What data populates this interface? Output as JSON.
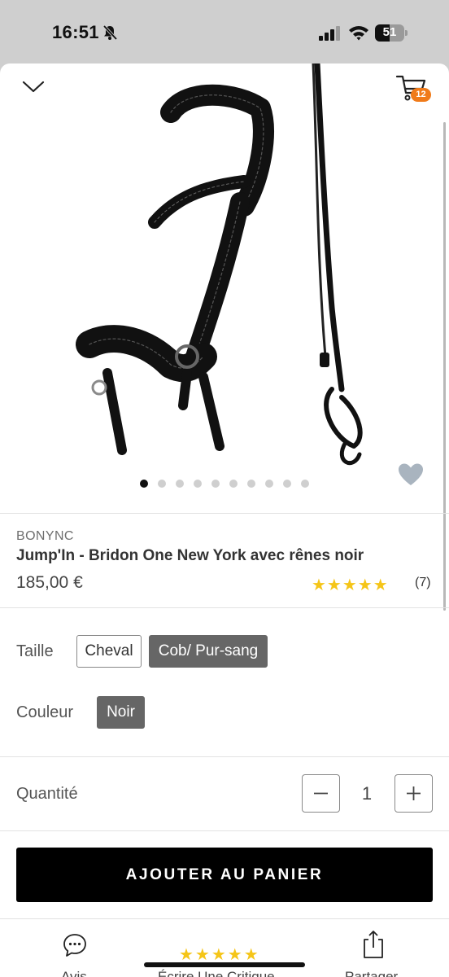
{
  "status_bar": {
    "time": "16:51",
    "battery": "51",
    "battery_level": 0.51
  },
  "header": {
    "cart_count": "12"
  },
  "gallery": {
    "image_count": 10,
    "active_index": 0
  },
  "product": {
    "brand": "BONYNC",
    "title": "Jump'In - Bridon One New York avec rênes noir",
    "price": "185,00 €",
    "rating_stars": "★★★★★",
    "rating_value": 5,
    "review_count": "(7)"
  },
  "options": {
    "size_label": "Taille",
    "sizes": [
      "Cheval",
      "Cob/ Pur-sang"
    ],
    "selected_size": "Cob/ Pur-sang",
    "color_label": "Couleur",
    "colors": [
      "Noir"
    ],
    "selected_color": "Noir"
  },
  "quantity": {
    "label": "Quantité",
    "value": "1",
    "minus": "−",
    "plus": "+"
  },
  "cta": {
    "add_to_cart": "AJOUTER AU PANIER"
  },
  "bottom_bar": {
    "reviews_label": "Avis",
    "write_review_label": "Écrire Une Critique",
    "write_review_stars": "★★★★★",
    "share_label": "Partager"
  },
  "colors": {
    "accent_badge": "#f07b1a",
    "star": "#f5c518",
    "selected_option": "#666666",
    "cta_bg": "#000000"
  }
}
